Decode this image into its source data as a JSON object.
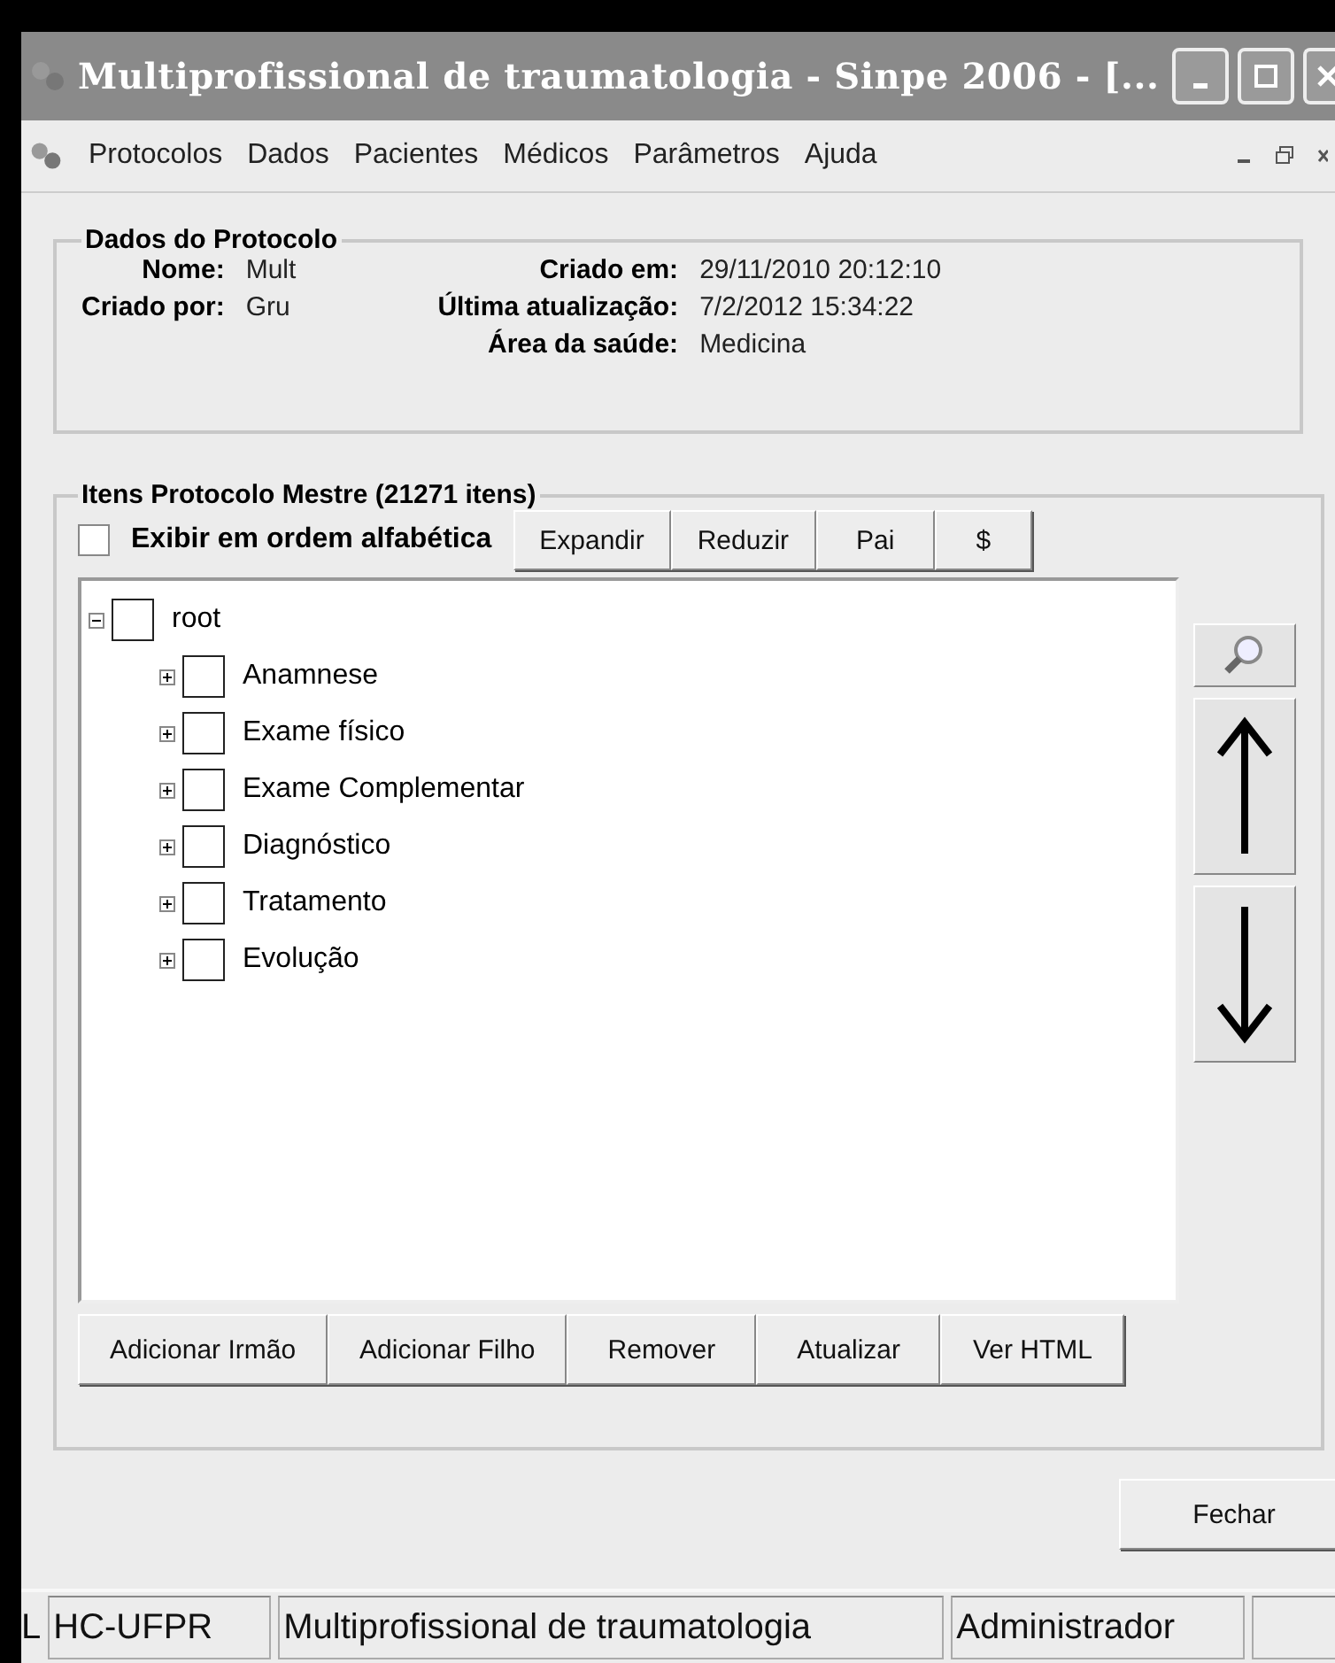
{
  "window": {
    "title": "Multiprofissional de traumatologia - Sinpe 2006 - [..."
  },
  "menu": [
    "Protocolos",
    "Dados",
    "Pacientes",
    "Médicos",
    "Parâmetros",
    "Ajuda"
  ],
  "protocol_data": {
    "title": "Dados do Protocolo",
    "left": [
      {
        "label": "Nome:",
        "value": "Mult"
      },
      {
        "label": "Criado por:",
        "value": "Gru"
      }
    ],
    "right": [
      {
        "label": "Criado em:",
        "value": "29/11/2010 20:12:10"
      },
      {
        "label": "Última atualização:",
        "value": "7/2/2012 15:34:22"
      },
      {
        "label": "Área da saúde:",
        "value": "Medicina"
      }
    ]
  },
  "items": {
    "title": "Itens Protocolo Mestre (21271 itens)",
    "alphabetical": {
      "label": "Exibir em ordem alfabética",
      "checked": false
    },
    "tree_buttons": [
      "Expandir",
      "Reduzir",
      "Pai",
      "$"
    ],
    "tree": [
      {
        "label": "root",
        "expanded": true,
        "checked": false,
        "children": [
          {
            "label": "Anamnese",
            "expanded": false,
            "checked": false
          },
          {
            "label": "Exame físico",
            "expanded": false,
            "checked": false
          },
          {
            "label": "Exame Complementar",
            "expanded": false,
            "checked": false
          },
          {
            "label": "Diagnóstico",
            "expanded": false,
            "checked": false
          },
          {
            "label": "Tratamento",
            "expanded": false,
            "checked": false
          },
          {
            "label": "Evolução",
            "expanded": false,
            "checked": false
          }
        ]
      }
    ],
    "actions": [
      "Adicionar Irmão",
      "Adicionar Filho",
      "Remover",
      "Atualizar",
      "Ver HTML"
    ]
  },
  "close_button": "Fechar",
  "status_bar": [
    "L",
    "HC-UFPR",
    "Multiprofissional de traumatologia",
    "Administrador"
  ]
}
